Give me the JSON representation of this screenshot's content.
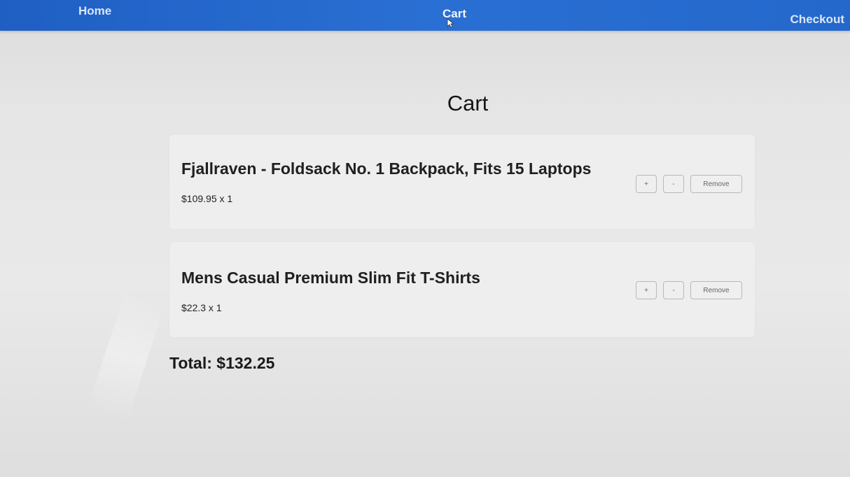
{
  "nav": {
    "home": "Home",
    "cart": "Cart",
    "checkout": "Checkout"
  },
  "page": {
    "title": "Cart"
  },
  "cart": {
    "items": [
      {
        "name": "Fjallraven - Foldsack No. 1 Backpack, Fits 15 Laptops",
        "price_qty": "$109.95 x 1",
        "increment_label": "+",
        "decrement_label": "-",
        "remove_label": "Remove"
      },
      {
        "name": "Mens Casual Premium Slim Fit T-Shirts",
        "price_qty": "$22.3 x 1",
        "increment_label": "+",
        "decrement_label": "-",
        "remove_label": "Remove"
      }
    ],
    "total": "Total: $132.25"
  },
  "colors": {
    "navbar": "#2468cc",
    "nav_text": "#dce6f5",
    "background": "#e6e6e6",
    "card": "#eeeeee"
  }
}
